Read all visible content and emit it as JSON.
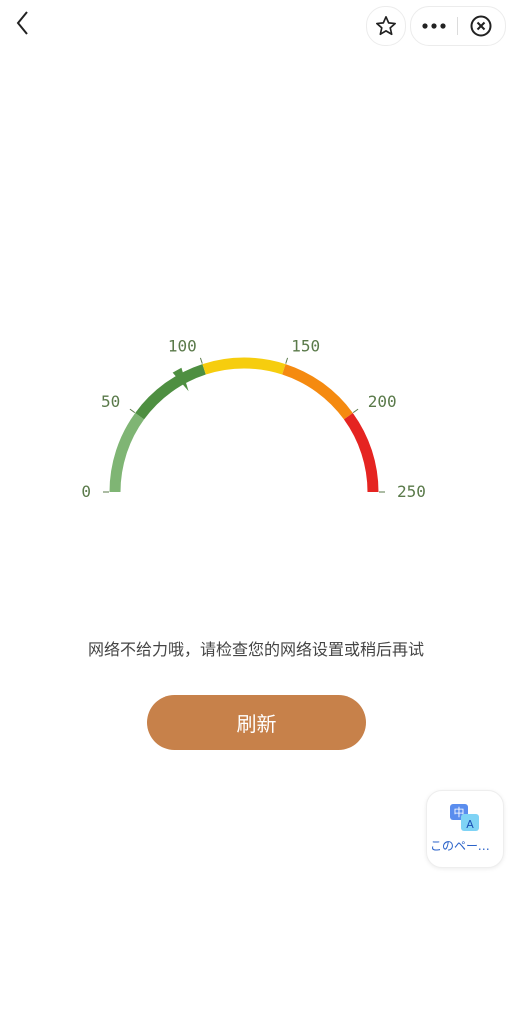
{
  "header": {
    "back_icon": "chevron-left-icon",
    "favorite_icon": "star-outline-icon",
    "more_icon": "more-dots-icon",
    "close_icon": "close-circle-icon"
  },
  "gauge": {
    "min": 0,
    "max": 250,
    "value": 85,
    "ticks": [
      {
        "value": 0,
        "label": "0"
      },
      {
        "value": 50,
        "label": "50"
      },
      {
        "value": 100,
        "label": "100"
      },
      {
        "value": 150,
        "label": "150"
      },
      {
        "value": 200,
        "label": "200"
      },
      {
        "value": 250,
        "label": "250"
      }
    ],
    "segments": [
      {
        "from": 0,
        "to": 50,
        "color": "#7fb574"
      },
      {
        "from": 50,
        "to": 100,
        "color": "#4e8f41"
      },
      {
        "from": 100,
        "to": 150,
        "color": "#f6cd0e"
      },
      {
        "from": 150,
        "to": 200,
        "color": "#f58a10"
      },
      {
        "from": 200,
        "to": 250,
        "color": "#e52421"
      }
    ],
    "needle_color": "#4e8f41"
  },
  "message": "网络不给力哦，请检查您的网络设置或稍后再试",
  "refresh_button": {
    "label": "刷新",
    "color": "#c7814a"
  },
  "translate_widget": {
    "icon": "translate-icon",
    "label": "このページ..."
  }
}
